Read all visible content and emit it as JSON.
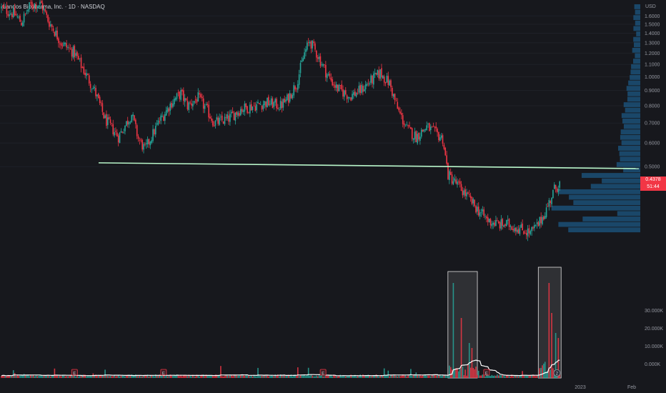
{
  "title": {
    "symbol_name": "Landos Biopharma, Inc.",
    "interval": "1D",
    "exchange": "NASDAQ"
  },
  "currency": "USD",
  "last_price": {
    "value": "0.4378",
    "countdown": "51:44"
  },
  "colors": {
    "background": "#17181d",
    "up": "#26a69a",
    "down": "#f23645",
    "level_line": "#b9f6ca",
    "volume_profile": "#1e6fa8",
    "volume_ma": "#ffffff"
  },
  "chart_data": [
    {
      "type": "candlestick",
      "series": [
        {
          "name": "Landos Biopharma, Inc."
        }
      ],
      "price_axis": {
        "scale": "log",
        "ticks": [
          "1.6000",
          "1.5000",
          "1.4000",
          "1.3000",
          "1.2000",
          "1.1000",
          "1.0000",
          "0.9000",
          "0.8000",
          "0.7000",
          "0.6000",
          "0.5000"
        ],
        "range": [
          0.27,
          1.75
        ]
      },
      "x_axis": {
        "visible_labels": [
          "2023",
          "Feb"
        ]
      },
      "horizontal_level": 0.5,
      "volume_profile_position": "right",
      "close_path_knots": [
        [
          0,
          1.7
        ],
        [
          10,
          1.62
        ],
        [
          15,
          1.52
        ],
        [
          22,
          1.75
        ],
        [
          30,
          1.75
        ],
        [
          35,
          1.55
        ],
        [
          45,
          1.3
        ],
        [
          55,
          1.2
        ],
        [
          62,
          1.05
        ],
        [
          70,
          0.9
        ],
        [
          78,
          0.72
        ],
        [
          88,
          0.63
        ],
        [
          98,
          0.75
        ],
        [
          103,
          0.62
        ],
        [
          108,
          0.57
        ],
        [
          118,
          0.7
        ],
        [
          128,
          0.82
        ],
        [
          135,
          0.88
        ],
        [
          140,
          0.8
        ],
        [
          148,
          0.85
        ],
        [
          155,
          0.77
        ],
        [
          160,
          0.7
        ],
        [
          170,
          0.72
        ],
        [
          180,
          0.78
        ],
        [
          190,
          0.8
        ],
        [
          200,
          0.82
        ],
        [
          210,
          0.8
        ],
        [
          215,
          0.84
        ],
        [
          222,
          0.95
        ],
        [
          228,
          1.2
        ],
        [
          232,
          1.32
        ],
        [
          238,
          1.18
        ],
        [
          245,
          1.02
        ],
        [
          252,
          0.92
        ],
        [
          262,
          0.86
        ],
        [
          270,
          0.9
        ],
        [
          278,
          0.97
        ],
        [
          285,
          1.03
        ],
        [
          292,
          0.95
        ],
        [
          298,
          0.78
        ],
        [
          305,
          0.67
        ],
        [
          312,
          0.63
        ],
        [
          320,
          0.68
        ],
        [
          328,
          0.64
        ],
        [
          332,
          0.62
        ],
        [
          336,
          0.47
        ],
        [
          342,
          0.44
        ],
        [
          350,
          0.4
        ],
        [
          358,
          0.36
        ],
        [
          366,
          0.33
        ],
        [
          374,
          0.32
        ],
        [
          382,
          0.32
        ],
        [
          390,
          0.31
        ],
        [
          398,
          0.3
        ],
        [
          404,
          0.32
        ],
        [
          410,
          0.36
        ],
        [
          416,
          0.42
        ],
        [
          420,
          0.44
        ]
      ],
      "volume": {
        "axis_ticks": [
          "30.000K",
          "20.000K",
          "10.000K",
          "0.000K"
        ],
        "spikes": [
          {
            "bar": 340,
            "relative": 0.95,
            "up": true
          },
          {
            "bar": 346,
            "relative": 0.6,
            "up": false
          },
          {
            "bar": 352,
            "relative": 0.35,
            "up": true
          },
          {
            "bar": 354,
            "relative": 0.3,
            "up": false
          },
          {
            "bar": 412,
            "relative": 0.95,
            "up": false
          },
          {
            "bar": 414,
            "relative": 0.65,
            "up": false
          },
          {
            "bar": 417,
            "relative": 0.45,
            "up": true
          },
          {
            "bar": 419,
            "relative": 0.4,
            "up": false
          }
        ],
        "highlight_boxes": [
          [
            337,
            357
          ],
          [
            405,
            420
          ]
        ]
      },
      "events": [
        {
          "bar": 55,
          "label": "E",
          "kind": "earnings"
        },
        {
          "bar": 122,
          "label": "E",
          "kind": "earnings"
        },
        {
          "bar": 242,
          "label": "E",
          "kind": "earnings"
        },
        {
          "bar": 365,
          "label": "E",
          "kind": "earnings"
        },
        {
          "bar": 418,
          "label": "2",
          "kind": "upcoming"
        }
      ]
    }
  ]
}
